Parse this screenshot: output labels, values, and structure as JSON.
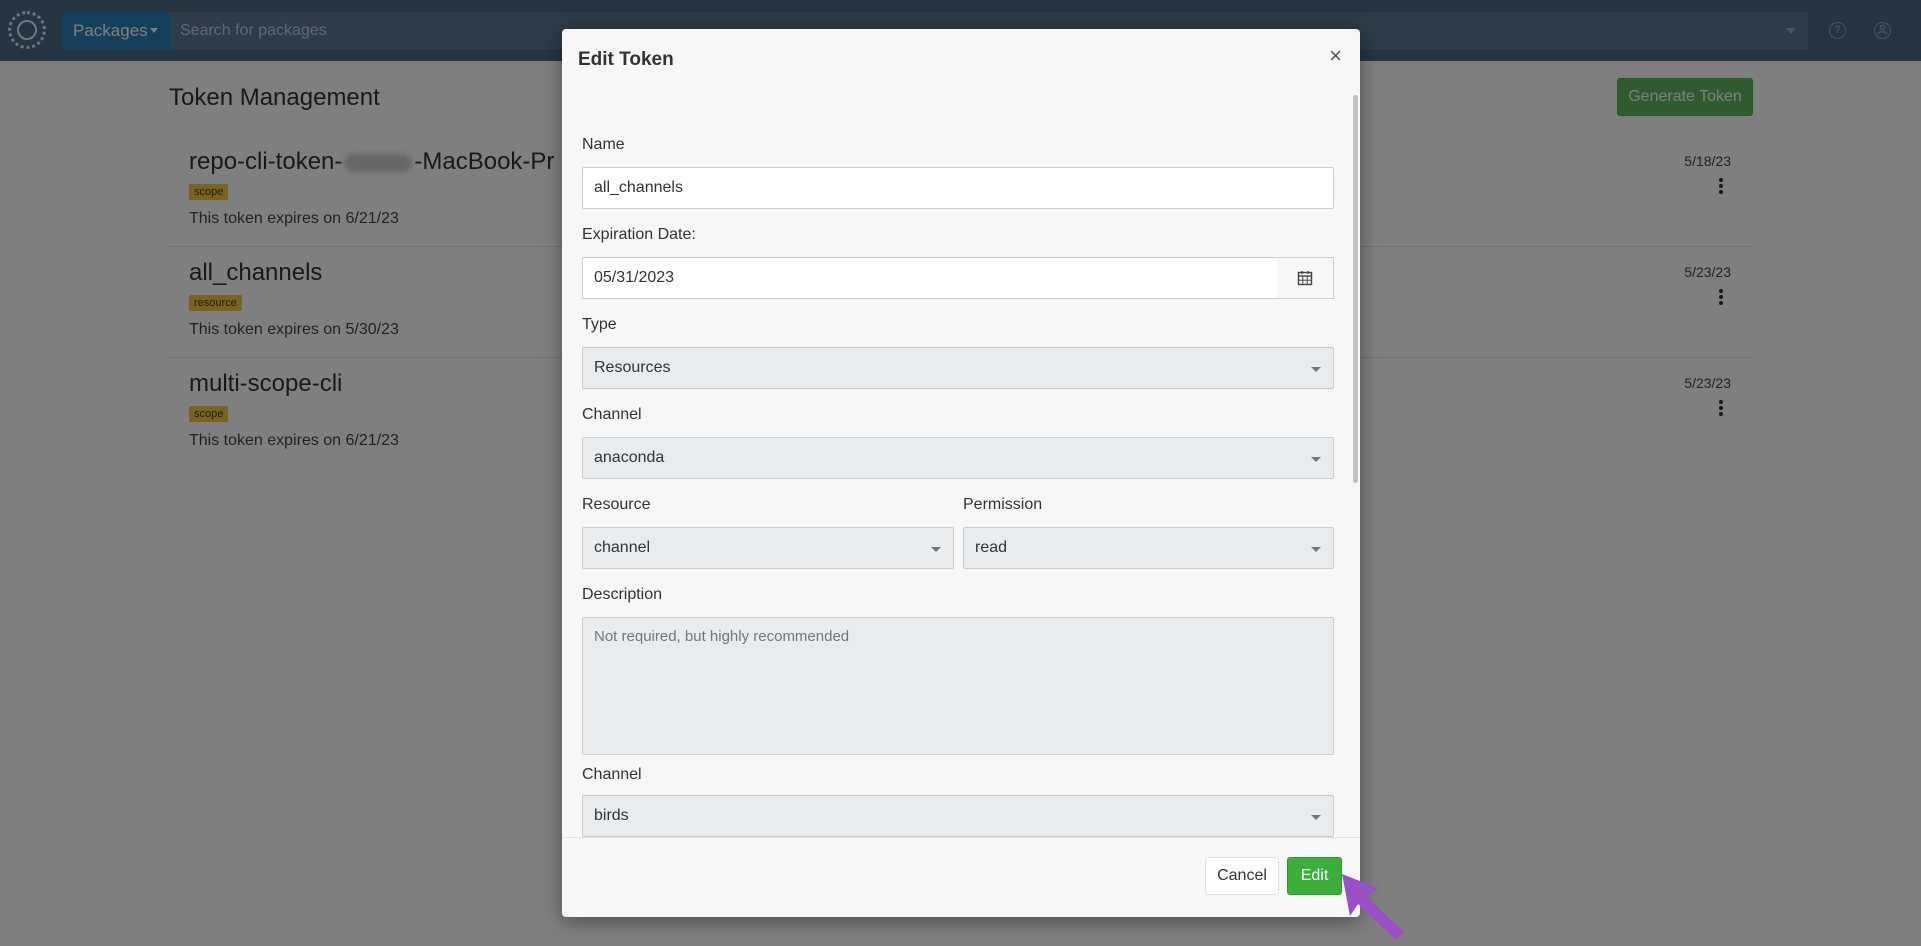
{
  "nav": {
    "packages_label": "Packages",
    "search_placeholder": "Search for packages",
    "help_icon": "help-circle-icon",
    "account_icon": "user-circle-icon"
  },
  "page": {
    "title": "Token Management",
    "generate_label": "Generate Token",
    "tokens": [
      {
        "name_prefix": "repo-cli-token-",
        "name_suffix": "-MacBook-Pr",
        "badge": "scope",
        "expires": "This token expires on 6/21/23",
        "date": "5/18/23"
      },
      {
        "name": "all_channels",
        "badge": "resource",
        "expires": "This token expires on 5/30/23",
        "date": "5/23/23"
      },
      {
        "name": "multi-scope-cli",
        "badge": "scope",
        "expires": "This token expires on 6/21/23",
        "date": "5/23/23"
      }
    ]
  },
  "modal": {
    "title": "Edit Token",
    "close_symbol": "×",
    "name_label": "Name",
    "name_value": "all_channels",
    "expiration_label": "Expiration Date:",
    "expiration_value": "05/31/2023",
    "type_label": "Type",
    "type_value": "Resources",
    "channel_label": "Channel",
    "channel_value": "anaconda",
    "resource_label": "Resource",
    "resource_value": "channel",
    "permission_label": "Permission",
    "permission_value": "read",
    "description_label": "Description",
    "description_placeholder": "Not required, but highly recommended",
    "channel2_label": "Channel",
    "channel2_value": "birds",
    "cancel_label": "Cancel",
    "edit_label": "Edit"
  },
  "colors": {
    "nav_bg": "#4a6a84",
    "primary_blue": "#2a80b9",
    "success_green": "#5cb85c",
    "edit_green": "#3cae3c",
    "badge_yellow": "#f0c93e",
    "pointer_purple": "#9b4fc7"
  }
}
